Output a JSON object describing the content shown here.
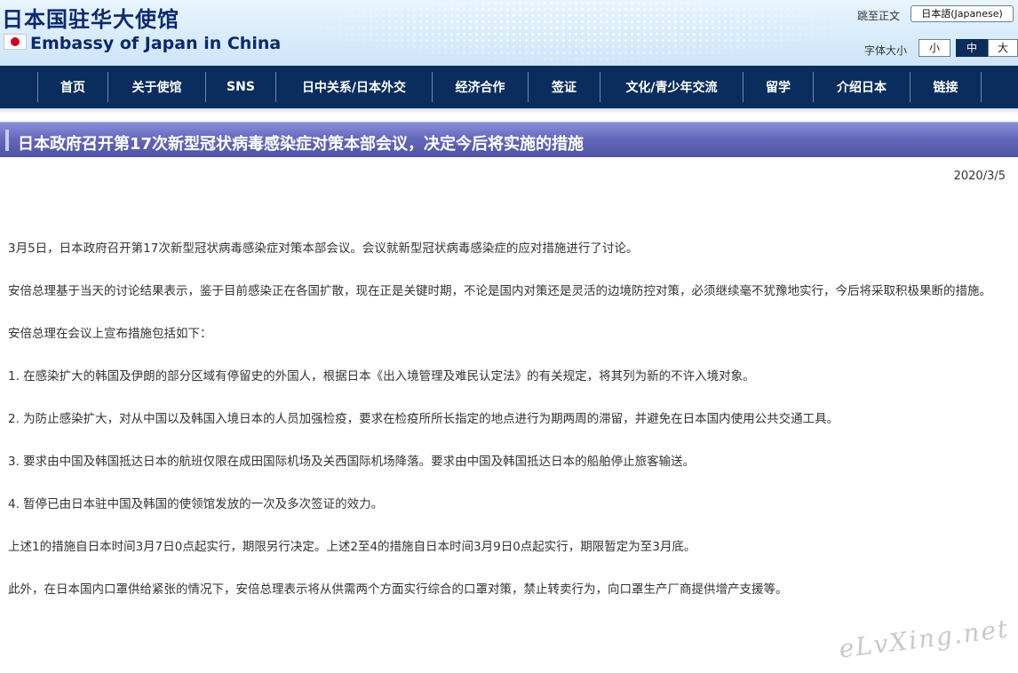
{
  "header": {
    "title_cn": "日本国驻华大使馆",
    "title_en": "Embassy of Japan in China",
    "skip_link": "跳至正文",
    "language_button": "日本語(Japanese)",
    "font_size_label": "字体大小",
    "font_sizes": [
      "小",
      "中",
      "大"
    ],
    "font_size_selected": "中"
  },
  "nav": {
    "items": [
      "首页",
      "关于使馆",
      "SNS",
      "日中关系/日本外交",
      "经济合作",
      "签证",
      "文化/青少年交流",
      "留学",
      "介绍日本",
      "链接"
    ]
  },
  "article": {
    "title": "日本政府召开第17次新型冠状病毒感染症对策本部会议，决定今后将实施的措施",
    "date": "2020/3/5",
    "paragraphs": [
      "3月5日，日本政府召开第17次新型冠状病毒感染症对策本部会议。会议就新型冠状病毒感染症的应对措施进行了讨论。",
      "安倍总理基于当天的讨论结果表示，鉴于目前感染正在各国扩散，现在正是关键时期，不论是国内对策还是灵活的边境防控对策，必须继续毫不犹豫地实行，今后将采取积极果断的措施。",
      "安倍总理在会议上宣布措施包括如下：",
      "1. 在感染扩大的韩国及伊朗的部分区域有停留史的外国人，根据日本《出入境管理及难民认定法》的有关规定，将其列为新的不许入境对象。",
      "2. 为防止感染扩大，对从中国以及韩国入境日本的人员加强检疫，要求在检疫所所长指定的地点进行为期两周的滞留，并避免在日本国内使用公共交通工具。",
      "3. 要求由中国及韩国抵达日本的航班仅限在成田国际机场及关西国际机场降落。要求由中国及韩国抵达日本的船舶停止旅客输送。",
      "4. 暂停已由日本驻中国及韩国的使领馆发放的一次及多次签证的效力。",
      "上述1的措施自日本时间3月7日0点起实行，期限另行决定。上述2至4的措施自日本时间3月9日0点起实行，期限暂定为至3月底。",
      "此外，在日本国内口罩供给紧张的情况下，安倍总理表示将从供需两个方面实行综合的口罩对策，禁止转卖行为，向口罩生产厂商提供增产支援等。"
    ]
  },
  "watermark": "eLvXing.net",
  "colors": {
    "nav_bg": "#0a2d5e",
    "title_bar": "#6569bd",
    "flag_red": "#d0021b",
    "brand_blue": "#0b2a6e"
  }
}
